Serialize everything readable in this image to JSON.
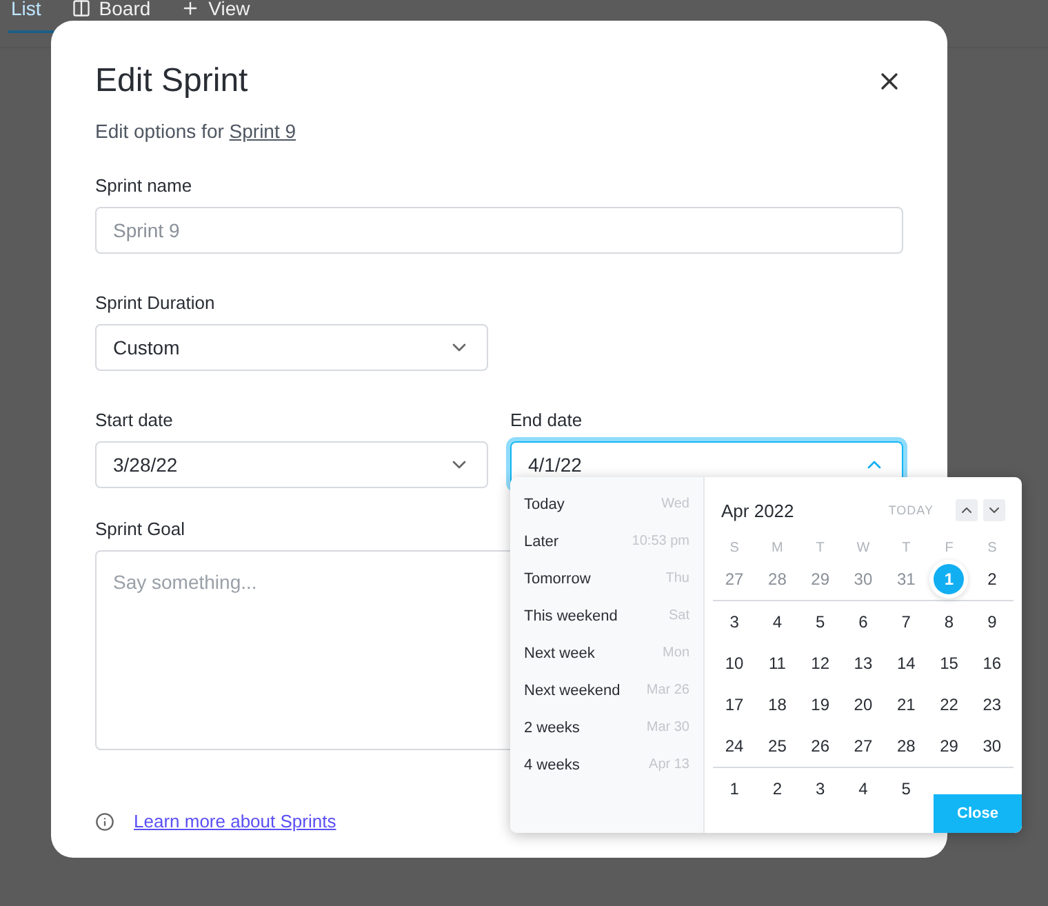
{
  "background_tabs": [
    {
      "label": "List",
      "selected": true
    },
    {
      "label": "Board",
      "selected": false
    },
    {
      "label": "View",
      "selected": false
    }
  ],
  "dialog": {
    "title": "Edit Sprint",
    "subtitle": "Edit options for ",
    "subtitle_link": "Sprint 9",
    "sprint_name": {
      "label": "Sprint name",
      "placeholder": "Sprint 9"
    },
    "sprint_duration": {
      "label": "Sprint Duration",
      "value": "Custom"
    },
    "start_date": {
      "label": "Start date",
      "value": "3/28/22",
      "focused": false
    },
    "end_date": {
      "label": "End date",
      "value": "4/1/22",
      "focused": true
    },
    "sprint_goal": {
      "label": "Sprint Goal",
      "placeholder": "Say something..."
    },
    "learn_more": "Learn more about Sprints"
  },
  "date_picker": {
    "shortcuts": [
      {
        "label": "Today",
        "hint": "Wed"
      },
      {
        "label": "Later",
        "hint": "10:53 pm"
      },
      {
        "label": "Tomorrow",
        "hint": "Thu"
      },
      {
        "label": "This weekend",
        "hint": "Sat"
      },
      {
        "label": "Next week",
        "hint": "Mon"
      },
      {
        "label": "Next weekend",
        "hint": "Mar 26"
      },
      {
        "label": "2 weeks",
        "hint": "Mar 30"
      },
      {
        "label": "4 weeks",
        "hint": "Apr 13"
      }
    ],
    "month": "Apr 2022",
    "today_button": "TODAY",
    "weekdays": [
      "S",
      "M",
      "T",
      "W",
      "T",
      "F",
      "S"
    ],
    "weeks": [
      [
        {
          "day": "27",
          "muted": true,
          "selected": false
        },
        {
          "day": "28",
          "muted": true,
          "selected": false
        },
        {
          "day": "29",
          "muted": true,
          "selected": false
        },
        {
          "day": "30",
          "muted": true,
          "selected": false
        },
        {
          "day": "31",
          "muted": true,
          "selected": false
        },
        {
          "day": "1",
          "muted": false,
          "selected": true
        },
        {
          "day": "2",
          "muted": false,
          "selected": false
        }
      ],
      [
        {
          "day": "3",
          "muted": false,
          "selected": false
        },
        {
          "day": "4",
          "muted": false,
          "selected": false
        },
        {
          "day": "5",
          "muted": false,
          "selected": false
        },
        {
          "day": "6",
          "muted": false,
          "selected": false
        },
        {
          "day": "7",
          "muted": false,
          "selected": false
        },
        {
          "day": "8",
          "muted": false,
          "selected": false
        },
        {
          "day": "9",
          "muted": false,
          "selected": false
        }
      ],
      [
        {
          "day": "10",
          "muted": false,
          "selected": false
        },
        {
          "day": "11",
          "muted": false,
          "selected": false
        },
        {
          "day": "12",
          "muted": false,
          "selected": false
        },
        {
          "day": "13",
          "muted": false,
          "selected": false
        },
        {
          "day": "14",
          "muted": false,
          "selected": false
        },
        {
          "day": "15",
          "muted": false,
          "selected": false
        },
        {
          "day": "16",
          "muted": false,
          "selected": false
        }
      ],
      [
        {
          "day": "17",
          "muted": false,
          "selected": false
        },
        {
          "day": "18",
          "muted": false,
          "selected": false
        },
        {
          "day": "19",
          "muted": false,
          "selected": false
        },
        {
          "day": "20",
          "muted": false,
          "selected": false
        },
        {
          "day": "21",
          "muted": false,
          "selected": false
        },
        {
          "day": "22",
          "muted": false,
          "selected": false
        },
        {
          "day": "23",
          "muted": false,
          "selected": false
        }
      ],
      [
        {
          "day": "24",
          "muted": false,
          "selected": false
        },
        {
          "day": "25",
          "muted": false,
          "selected": false
        },
        {
          "day": "26",
          "muted": false,
          "selected": false
        },
        {
          "day": "27",
          "muted": false,
          "selected": false
        },
        {
          "day": "28",
          "muted": false,
          "selected": false
        },
        {
          "day": "29",
          "muted": false,
          "selected": false
        },
        {
          "day": "30",
          "muted": false,
          "selected": false
        }
      ],
      [
        {
          "day": "1",
          "muted": false,
          "selected": false
        },
        {
          "day": "2",
          "muted": false,
          "selected": false
        },
        {
          "day": "3",
          "muted": false,
          "selected": false
        },
        {
          "day": "4",
          "muted": false,
          "selected": false
        },
        {
          "day": "5",
          "muted": false,
          "selected": false
        }
      ]
    ],
    "close_button": "Close"
  }
}
